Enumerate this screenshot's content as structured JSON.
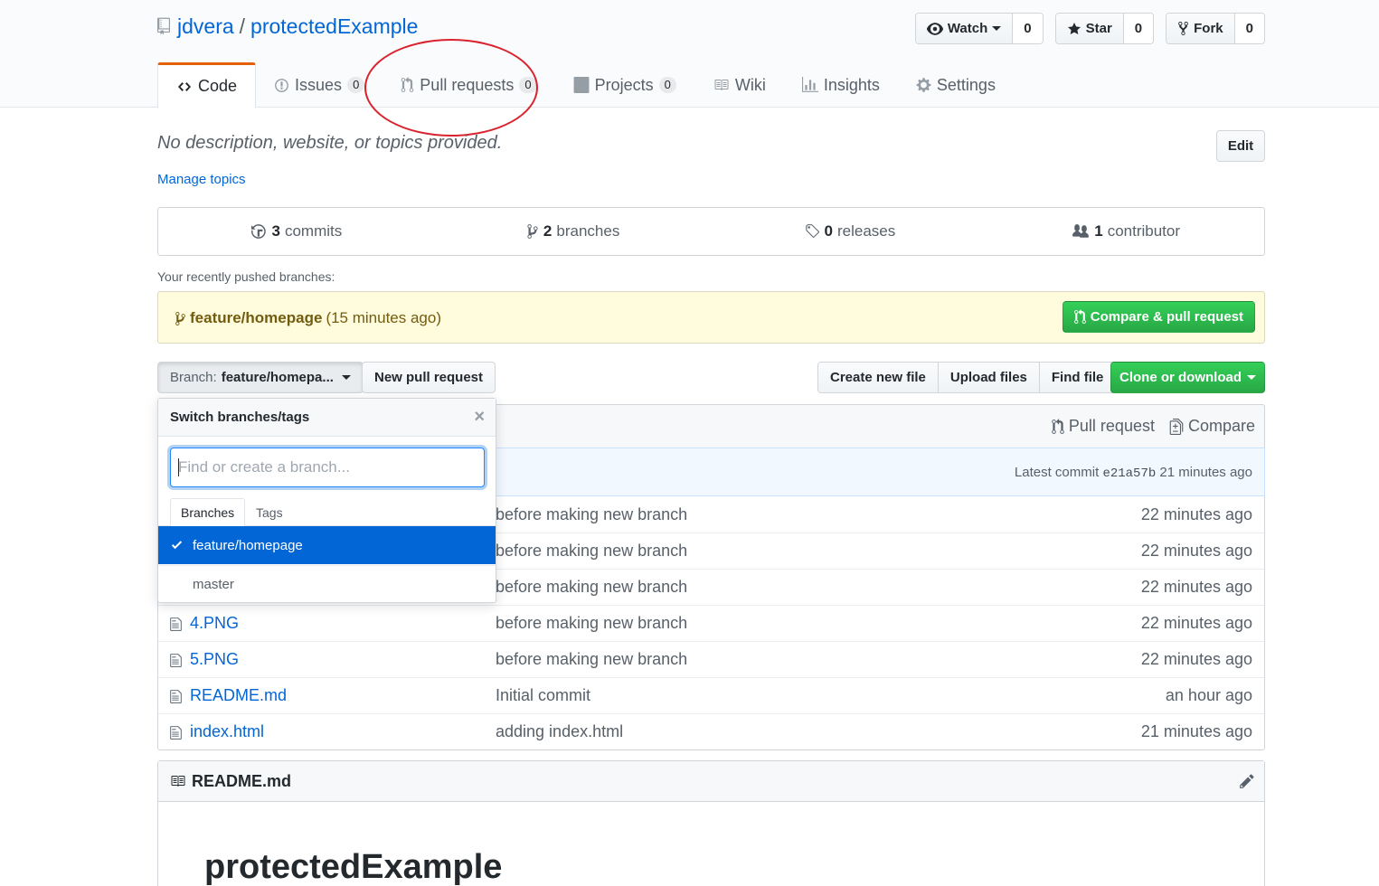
{
  "repo": {
    "owner": "jdvera",
    "separator": "/",
    "name": "protectedExample"
  },
  "actions": {
    "watch_label": "Watch",
    "watch_count": "0",
    "star_label": "Star",
    "star_count": "0",
    "fork_label": "Fork",
    "fork_count": "0"
  },
  "tabs": [
    {
      "label": "Code",
      "icon": "code-icon"
    },
    {
      "label": "Issues",
      "count": "0",
      "icon": "issue-icon"
    },
    {
      "label": "Pull requests",
      "count": "0",
      "icon": "pull-request-icon"
    },
    {
      "label": "Projects",
      "count": "0",
      "icon": "project-icon"
    },
    {
      "label": "Wiki",
      "icon": "book-icon"
    },
    {
      "label": "Insights",
      "icon": "graph-icon"
    },
    {
      "label": "Settings",
      "icon": "gear-icon"
    }
  ],
  "description": "No description, website, or topics provided.",
  "edit_label": "Edit",
  "manage_topics": "Manage topics",
  "summary": {
    "commits_num": "3",
    "commits_label": "commits",
    "branches_num": "2",
    "branches_label": "branches",
    "releases_num": "0",
    "releases_label": "releases",
    "contributors_num": "1",
    "contributors_label": "contributor"
  },
  "recent": {
    "label": "Your recently pushed branches:",
    "branch": "feature/homepage",
    "time": "(15 minutes ago)",
    "compare_label": "Compare & pull request"
  },
  "filenav": {
    "branch_prefix": "Branch:",
    "branch_current": "feature/homepa...",
    "new_pr": "New pull request",
    "create_file": "Create new file",
    "upload_files": "Upload files",
    "find_file": "Find file",
    "clone": "Clone or download"
  },
  "tease": {
    "pull_request": "Pull request",
    "compare": "Compare",
    "latest_label": "Latest commit",
    "sha": "e21a57b",
    "age": "21 minutes ago"
  },
  "files": [
    {
      "name": "",
      "message": "before making new branch",
      "age": "22 minutes ago"
    },
    {
      "name": "",
      "message": "before making new branch",
      "age": "22 minutes ago"
    },
    {
      "name": "",
      "message": "before making new branch",
      "age": "22 minutes ago"
    },
    {
      "name": "4.PNG",
      "message": "before making new branch",
      "age": "22 minutes ago"
    },
    {
      "name": "5.PNG",
      "message": "before making new branch",
      "age": "22 minutes ago"
    },
    {
      "name": "README.md",
      "message": "Initial commit",
      "age": "an hour ago"
    },
    {
      "name": "index.html",
      "message": "adding index.html",
      "age": "21 minutes ago"
    }
  ],
  "readme": {
    "filename": "README.md",
    "heading": "protectedExample"
  },
  "dropdown": {
    "title": "Switch branches/tags",
    "close": "×",
    "placeholder": "Find or create a branch...",
    "tab_branches": "Branches",
    "tab_tags": "Tags",
    "selected_branch": "feature/homepage",
    "other_branch": "master"
  },
  "colors": {
    "accent": "#0366d6",
    "green": "#28a745",
    "annotation": "#d9232e",
    "tab_highlight": "#e36209"
  }
}
